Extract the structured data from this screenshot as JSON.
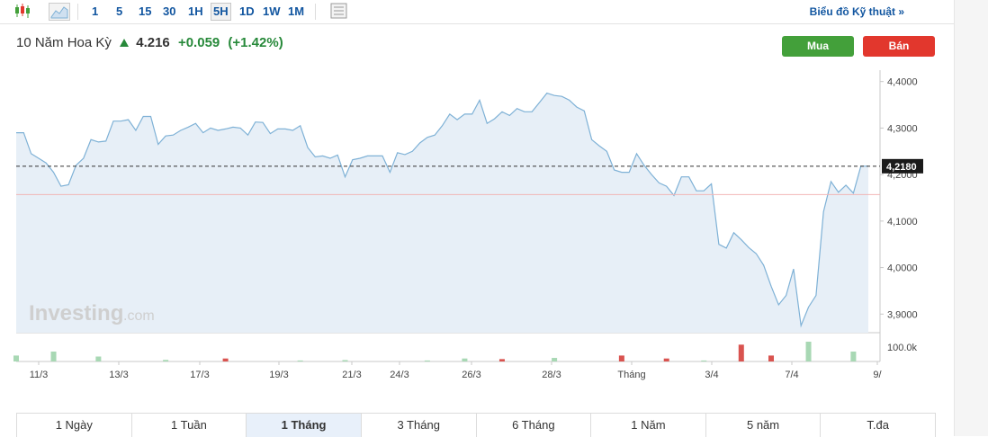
{
  "toolbar": {
    "intervals": [
      "1",
      "5",
      "15",
      "30",
      "1H",
      "5H",
      "1D",
      "1W",
      "1M"
    ],
    "active_interval": "5H",
    "technical_link": "Biểu đồ Kỹ thuật »"
  },
  "instrument": {
    "name": "10 Năm Hoa Kỳ",
    "price": "4.216",
    "change": "+0.059",
    "change_pct": "(+1.42%)"
  },
  "actions": {
    "buy": "Mua",
    "sell": "Bán"
  },
  "ranges": [
    "1 Ngày",
    "1 Tuần",
    "1 Tháng",
    "3 Tháng",
    "6 Tháng",
    "1 Năm",
    "5 năm",
    "T.đa"
  ],
  "active_range": "1 Tháng",
  "watermark": {
    "brand": "Investing",
    "suffix": ".com"
  },
  "colors": {
    "line": "#7eb1d6",
    "area": "#e7eff7",
    "up": "#27893a",
    "volume_up": "#a8d8b4",
    "volume_down": "#d9534f",
    "ref_line": "#f2b6b6"
  },
  "chart_data": {
    "type": "area",
    "y_ticks": [
      "4,4000",
      "4,3000",
      "4,2000",
      "4,1000",
      "4,0000",
      "3,9000"
    ],
    "ylim": [
      3.86,
      4.44
    ],
    "x_ticks": [
      "11/3",
      "13/3",
      "17/3",
      "19/3",
      "21/3",
      "24/3",
      "26/3",
      "28/3",
      "Tháng",
      "3/4",
      "7/4",
      "9/"
    ],
    "current_label": "4,2180",
    "current_value": 4.218,
    "reference_value": 4.157,
    "volume_label": "100.0k",
    "values": [
      4.29,
      4.29,
      4.245,
      4.235,
      4.225,
      4.205,
      4.175,
      4.178,
      4.22,
      4.235,
      4.275,
      4.27,
      4.272,
      4.315,
      4.315,
      4.318,
      4.295,
      4.325,
      4.325,
      4.265,
      4.283,
      4.285,
      4.295,
      4.302,
      4.31,
      4.29,
      4.3,
      4.295,
      4.298,
      4.302,
      4.3,
      4.285,
      4.313,
      4.312,
      4.288,
      4.298,
      4.298,
      4.295,
      4.305,
      4.258,
      4.238,
      4.24,
      4.235,
      4.242,
      4.195,
      4.232,
      4.235,
      4.24,
      4.24,
      4.24,
      4.205,
      4.247,
      4.243,
      4.25,
      4.268,
      4.28,
      4.285,
      4.305,
      4.33,
      4.318,
      4.33,
      4.33,
      4.36,
      4.31,
      4.32,
      4.335,
      4.327,
      4.342,
      4.335,
      4.335,
      4.355,
      4.375,
      4.37,
      4.368,
      4.36,
      4.345,
      4.337,
      4.275,
      4.262,
      4.25,
      4.21,
      4.205,
      4.205,
      4.245,
      4.22,
      4.2,
      4.182,
      4.175,
      4.155,
      4.195,
      4.195,
      4.165,
      4.165,
      4.18,
      4.05,
      4.042,
      4.075,
      4.06,
      4.043,
      4.03,
      4.005,
      3.96,
      3.92,
      3.94,
      3.997,
      3.875,
      3.915,
      3.94,
      4.12,
      4.185,
      4.162,
      4.177,
      4.16,
      4.218,
      4.218
    ],
    "volume": [
      {
        "i": 0,
        "h": 0.3,
        "dir": "up"
      },
      {
        "i": 5,
        "h": 0.5,
        "dir": "up"
      },
      {
        "i": 11,
        "h": 0.25,
        "dir": "up"
      },
      {
        "i": 20,
        "h": 0.08,
        "dir": "up"
      },
      {
        "i": 28,
        "h": 0.15,
        "dir": "down"
      },
      {
        "i": 38,
        "h": 0.05,
        "dir": "up"
      },
      {
        "i": 44,
        "h": 0.07,
        "dir": "up"
      },
      {
        "i": 55,
        "h": 0.05,
        "dir": "up"
      },
      {
        "i": 60,
        "h": 0.15,
        "dir": "up"
      },
      {
        "i": 65,
        "h": 0.12,
        "dir": "down"
      },
      {
        "i": 72,
        "h": 0.18,
        "dir": "up"
      },
      {
        "i": 81,
        "h": 0.3,
        "dir": "down"
      },
      {
        "i": 87,
        "h": 0.15,
        "dir": "down"
      },
      {
        "i": 92,
        "h": 0.05,
        "dir": "up"
      },
      {
        "i": 97,
        "h": 0.85,
        "dir": "down"
      },
      {
        "i": 101,
        "h": 0.3,
        "dir": "down"
      },
      {
        "i": 106,
        "h": 1.0,
        "dir": "up"
      },
      {
        "i": 112,
        "h": 0.5,
        "dir": "up"
      }
    ]
  }
}
